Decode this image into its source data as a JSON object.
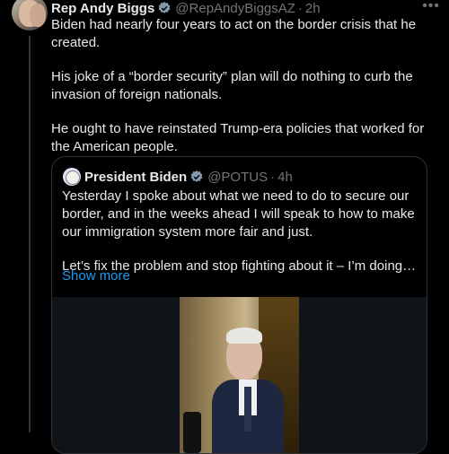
{
  "tweet": {
    "author_name": "Rep Andy Biggs",
    "handle": "@RepAndyBiggsAZ",
    "separator": "·",
    "time": "2h",
    "more_icon": "more-icon",
    "paragraphs": [
      "Biden had nearly four years to act on the border crisis that he created.",
      "His joke of a “border security” plan will do nothing to curb the invasion of foreign nationals.",
      "He ought to have reinstated Trump-era policies that worked for the American people."
    ]
  },
  "quoted": {
    "author_name": "President Biden",
    "handle": "@POTUS",
    "separator": "·",
    "time": "4h",
    "paragraphs": [
      "Yesterday I spoke about what we need to do to secure our border, and in the weeks ahead I will speak to how to make our immigration system more fair and just.",
      "Let’s fix the problem and stop fighting about it – I’m doing m…"
    ],
    "show_more": "Show more"
  },
  "colors": {
    "background": "#000000",
    "text": "#e7e9ea",
    "muted": "#71767b",
    "link": "#1d9bf0",
    "border": "#2f3336",
    "verified_badge": "#829aab"
  }
}
